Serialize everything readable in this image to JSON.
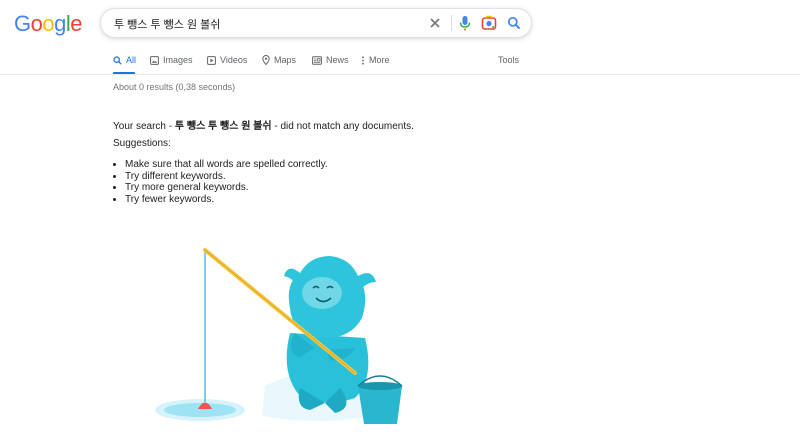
{
  "logo": {
    "letters": [
      "G",
      "o",
      "o",
      "g",
      "l",
      "e"
    ],
    "colors": [
      "#4285F4",
      "#EA4335",
      "#FBBC05",
      "#4285F4",
      "#34A853",
      "#EA4335"
    ]
  },
  "search": {
    "query": "투 뺑스 투 뺑스 원 볼쉬",
    "accent": "#1a73e8"
  },
  "tabs": [
    {
      "label": "All",
      "icon": "search-icon",
      "active": true
    },
    {
      "label": "Images",
      "icon": "image-icon"
    },
    {
      "label": "Videos",
      "icon": "play-icon"
    },
    {
      "label": "Maps",
      "icon": "map-pin-icon"
    },
    {
      "label": "News",
      "icon": "news-icon"
    },
    {
      "label": "More",
      "icon": "more-vert-icon"
    }
  ],
  "tools_label": "Tools",
  "stats": "About 0 results (0,38 seconds)",
  "message": {
    "prefix": "Your search - ",
    "term": "투 뺑스 투 뺑스 원 볼쉬",
    "suffix": " - did not match any documents."
  },
  "suggestions_title": "Suggestions:",
  "suggestions": [
    "Make sure that all words are spelled correctly.",
    "Try different keywords.",
    "Try more general keywords.",
    "Try fewer keywords."
  ]
}
